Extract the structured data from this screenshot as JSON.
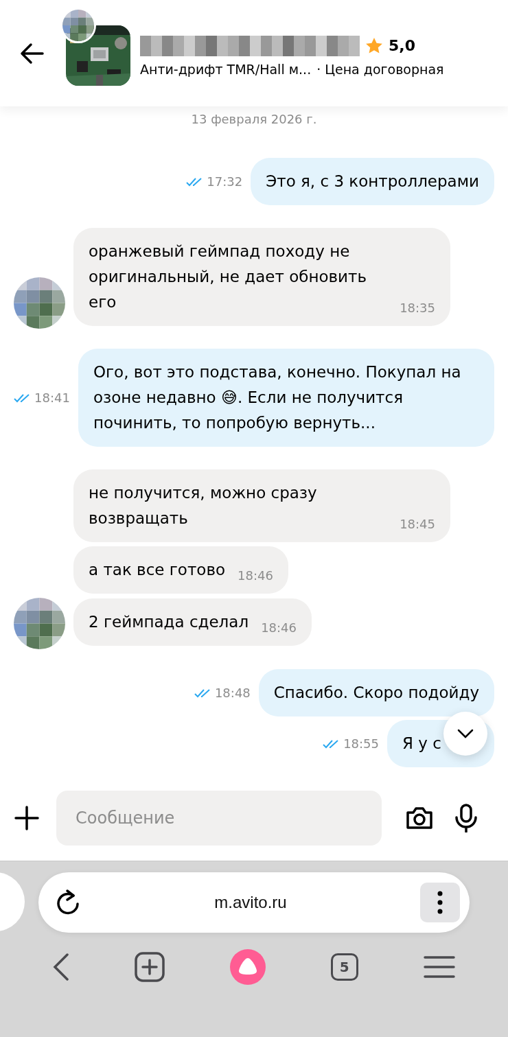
{
  "header": {
    "rating": "5,0",
    "listing_title": "Анти-дрифт TMR/Hall м...",
    "price": "· Цена договорная"
  },
  "date": "13 февраля 2026 г.",
  "messages": [
    {
      "kind": "out",
      "text": "Это я, с 3 контроллерами",
      "time": "17:32",
      "read": true
    },
    {
      "kind": "in",
      "text": "оранжевый геймпад походу не оригинальный, не дает обновить его",
      "time": "18:35",
      "avatar": true
    },
    {
      "kind": "out",
      "text": "Ого, вот это подстава, конечно. Покупал на озоне недавно 😅. Если не получится починить, то попробую вернуть...",
      "time": "18:41",
      "read": true
    },
    {
      "kind": "in",
      "text": "не получится, можно сразу возвращать",
      "time": "18:45",
      "avatar": false
    },
    {
      "kind": "in",
      "text": "а так все готово",
      "time": "18:46",
      "avatar": false
    },
    {
      "kind": "in",
      "text": "2 геймпада сделал",
      "time": "18:46",
      "avatar": true
    },
    {
      "kind": "out",
      "text": "Спасибо. Скоро подойду",
      "time": "18:48",
      "read": true
    },
    {
      "kind": "out",
      "text": "Я у с",
      "time": "18:55",
      "read": true,
      "clipped": true
    }
  ],
  "composer": {
    "placeholder": "Сообщение"
  },
  "browser": {
    "url": "m.avito.ru",
    "tab_count": "5"
  }
}
